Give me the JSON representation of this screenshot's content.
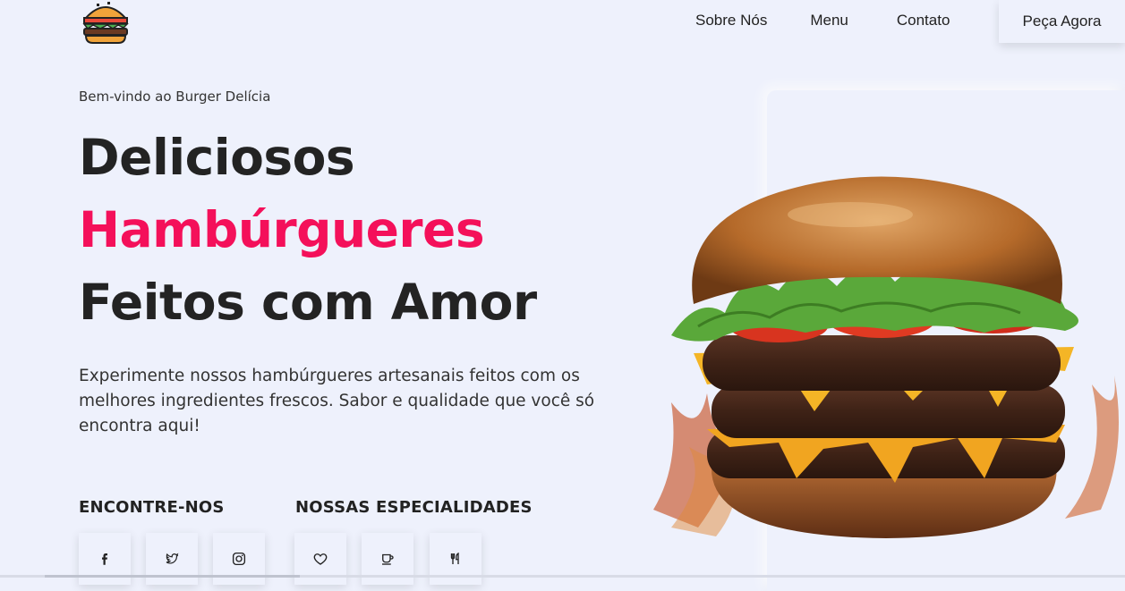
{
  "nav": {
    "links": [
      "Sobre Nós",
      "Menu",
      "Contato"
    ],
    "cta": "Peça Agora",
    "logo_icon": "burger-logo-icon"
  },
  "hero": {
    "welcome": "Bem-vindo ao Burger Delícia",
    "title_line1": "Deliciosos",
    "title_line2": "Hambúrgueres",
    "title_line3": "Feitos com Amor",
    "description": "Experimente nossos hambúrgueres artesanais feitos com os melhores ingredientes frescos. Sabor e qualidade que você só encontra aqui!"
  },
  "sections": {
    "find_us": "ENCONTRE-NOS",
    "specialties": "NOSSAS ESPECIALIDADES"
  },
  "social_icons": [
    "facebook-icon",
    "twitter-icon",
    "instagram-icon"
  ],
  "specialty_icons": [
    "heart-icon",
    "coffee-cup-icon",
    "utensils-icon"
  ],
  "colors": {
    "background": "#eef1fc",
    "accent": "#f4105a",
    "text": "#232323"
  }
}
